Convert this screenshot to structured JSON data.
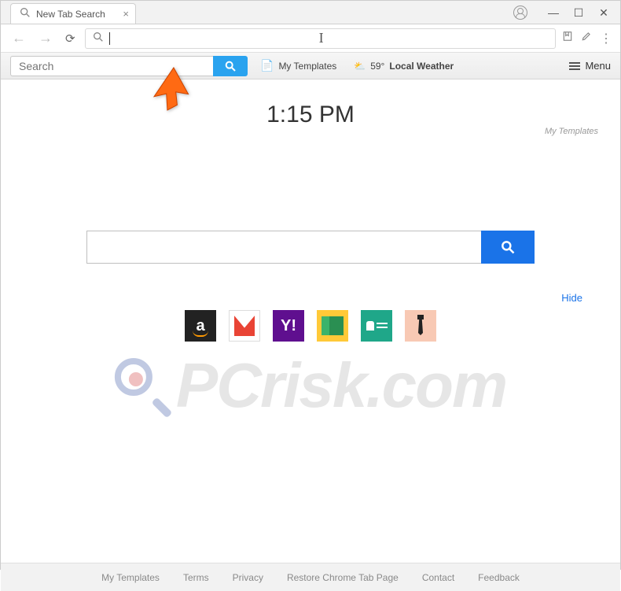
{
  "browser": {
    "tab_title": "New Tab Search",
    "omnibox_value": ""
  },
  "toolbar": {
    "search_placeholder": "Search",
    "templates_label": "My Templates",
    "weather_temp": "59°",
    "weather_label": "Local Weather",
    "menu_label": "Menu"
  },
  "page": {
    "clock": "1:15 PM",
    "top_right_link": "My Templates",
    "hide_label": "Hide"
  },
  "tiles": {
    "amazon": "a",
    "yahoo": "Y!"
  },
  "footer": {
    "links": [
      "My Templates",
      "Terms",
      "Privacy",
      "Restore Chrome Tab Page",
      "Contact",
      "Feedback"
    ]
  },
  "watermark": {
    "text": "PCrisk.com"
  }
}
